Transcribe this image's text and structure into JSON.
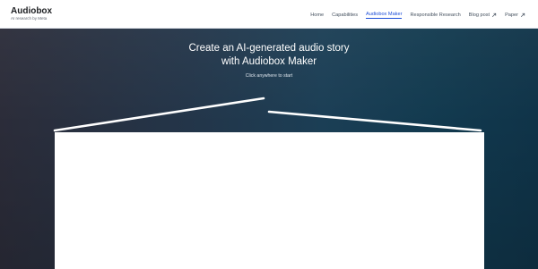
{
  "brand": {
    "title": "Audiobox",
    "subtitle": "AI research by Meta"
  },
  "nav": {
    "items": [
      {
        "label": "Home",
        "active": false,
        "external": false
      },
      {
        "label": "Capabilities",
        "active": false,
        "external": false
      },
      {
        "label": "Audiobox Maker",
        "active": true,
        "external": false
      },
      {
        "label": "Responsible Research",
        "active": false,
        "external": false
      },
      {
        "label": "Blog post",
        "active": false,
        "external": true
      },
      {
        "label": "Paper",
        "active": false,
        "external": true
      }
    ]
  },
  "hero": {
    "title_line1": "Create an AI-generated audio story",
    "title_line2": "with Audiobox Maker",
    "hint": "Click anywhere to start"
  },
  "colors": {
    "accent": "#1d4ed8",
    "hero_dark": "#233549",
    "hero_teal": "#0f3348"
  }
}
